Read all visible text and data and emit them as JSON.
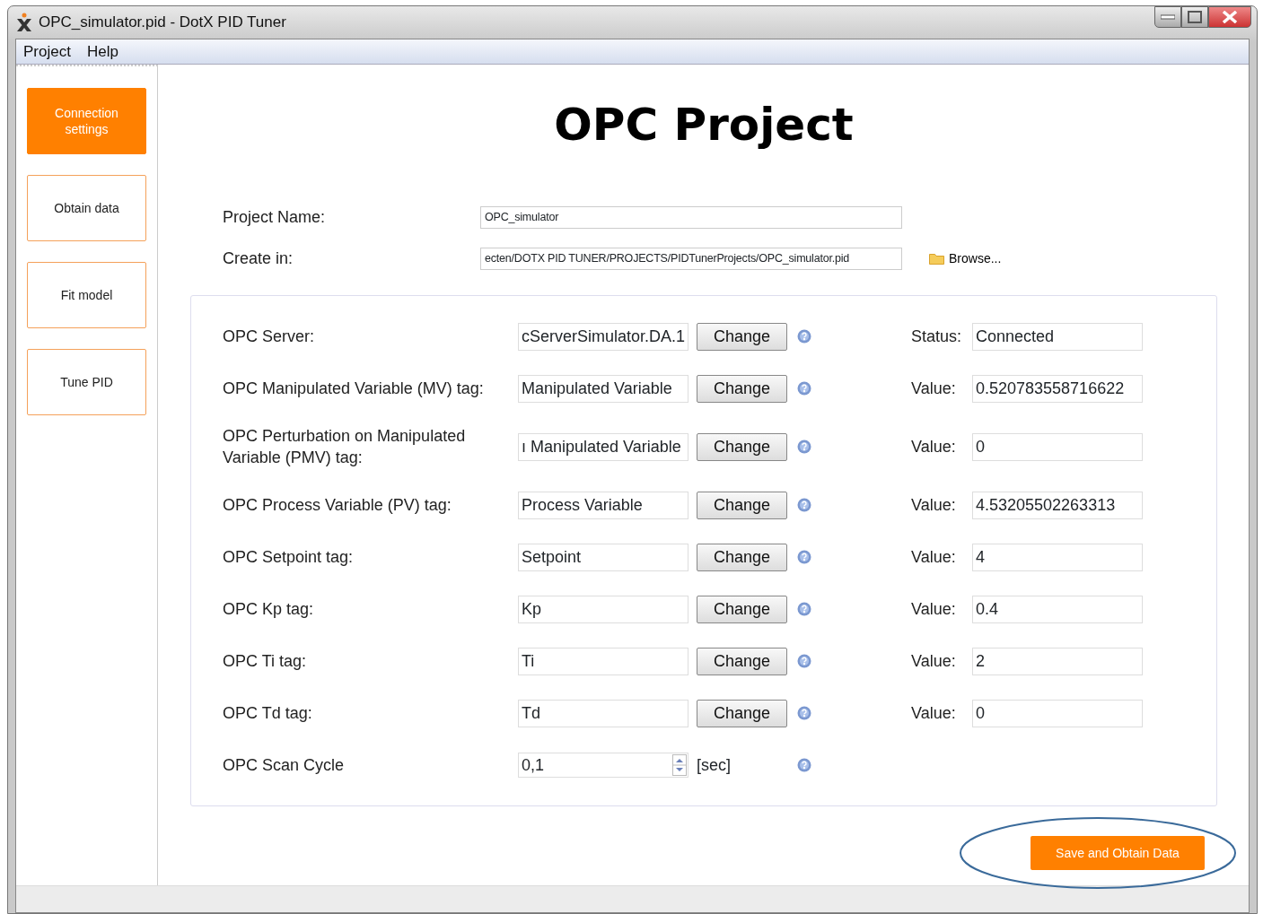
{
  "window": {
    "title": "OPC_simulator.pid - DotX PID Tuner"
  },
  "menu": [
    "Project",
    "Help"
  ],
  "sidebar": {
    "items": [
      {
        "label": "Connection settings",
        "selected": true
      },
      {
        "label": "Obtain data",
        "selected": false
      },
      {
        "label": "Fit model",
        "selected": false
      },
      {
        "label": "Tune PID",
        "selected": false
      }
    ]
  },
  "heading": "OPC Project",
  "project": {
    "name_label": "Project Name:",
    "name_value": "OPC_simulator",
    "create_label": "Create in:",
    "create_value": "ecten/DOTX PID TUNER/PROJECTS/PIDTunerProjects/OPC_simulator.pid",
    "browse": "Browse..."
  },
  "rows": [
    {
      "kind": "tag",
      "label": "OPC Server:",
      "value": "cServerSimulator.DA.1",
      "button": "Change",
      "right_label": "Status:",
      "right_value": "Connected"
    },
    {
      "kind": "tag",
      "label": "OPC Manipulated Variable (MV) tag:",
      "value": "Manipulated Variable",
      "button": "Change",
      "right_label": "Value:",
      "right_value": "0.520783558716622"
    },
    {
      "kind": "tag",
      "label": "OPC Perturbation on Manipulated Variable (PMV) tag:",
      "value": "ı Manipulated Variable",
      "button": "Change",
      "right_label": "Value:",
      "right_value": "0"
    },
    {
      "kind": "tag",
      "label": "OPC Process Variable (PV) tag:",
      "value": "Process Variable",
      "button": "Change",
      "right_label": "Value:",
      "right_value": "4.53205502263313"
    },
    {
      "kind": "tag",
      "label": "OPC Setpoint tag:",
      "value": "Setpoint",
      "button": "Change",
      "right_label": "Value:",
      "right_value": "4"
    },
    {
      "kind": "tag",
      "label": "OPC Kp tag:",
      "value": "Kp",
      "button": "Change",
      "right_label": "Value:",
      "right_value": "0.4"
    },
    {
      "kind": "tag",
      "label": "OPC Ti tag:",
      "value": "Ti",
      "button": "Change",
      "right_label": "Value:",
      "right_value": "2"
    },
    {
      "kind": "tag",
      "label": "OPC Td tag:",
      "value": "Td",
      "button": "Change",
      "right_label": "Value:",
      "right_value": "0"
    },
    {
      "kind": "spin",
      "label": "OPC Scan Cycle",
      "value": "0,1",
      "unit": "[sec]"
    }
  ],
  "save_button": "Save and Obtain Data"
}
